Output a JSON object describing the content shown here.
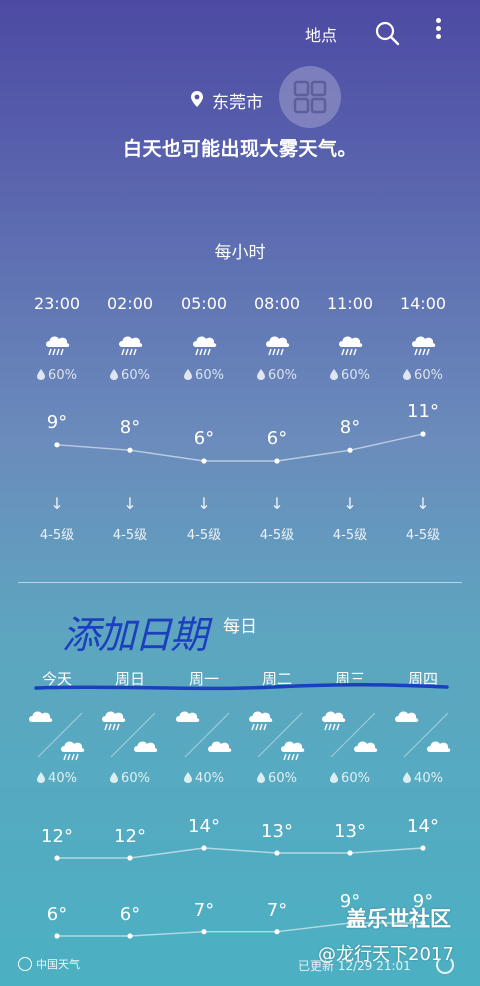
{
  "topbar": {
    "location_label": "地点",
    "search_icon": "search-icon",
    "more_icon": "more-vertical-icon"
  },
  "location": {
    "city": "东莞市",
    "pin_icon": "location-pin-icon",
    "badge_icon": "grid-icon"
  },
  "summary": "白天也可能出现大雾天气。",
  "hourly": {
    "title": "每小时",
    "items": [
      {
        "time": "23:00",
        "icon": "rain-cloud-icon",
        "precip": "60%",
        "temp": "9°",
        "temp_value": 9,
        "wind_arrow": "↓",
        "wind_level": "4-5级"
      },
      {
        "time": "02:00",
        "icon": "rain-cloud-icon",
        "precip": "60%",
        "temp": "8°",
        "temp_value": 8,
        "wind_arrow": "↓",
        "wind_level": "4-5级"
      },
      {
        "time": "05:00",
        "icon": "rain-cloud-icon",
        "precip": "60%",
        "temp": "6°",
        "temp_value": 6,
        "wind_arrow": "↓",
        "wind_level": "4-5级"
      },
      {
        "time": "08:00",
        "icon": "rain-cloud-icon",
        "precip": "60%",
        "temp": "6°",
        "temp_value": 6,
        "wind_arrow": "↓",
        "wind_level": "4-5级"
      },
      {
        "time": "11:00",
        "icon": "rain-cloud-icon",
        "precip": "60%",
        "temp": "8°",
        "temp_value": 8,
        "wind_arrow": "↓",
        "wind_level": "4-5级"
      },
      {
        "time": "14:00",
        "icon": "rain-cloud-icon",
        "precip": "60%",
        "temp": "11°",
        "temp_value": 11,
        "wind_arrow": "↓",
        "wind_level": "4-5级"
      }
    ]
  },
  "daily": {
    "title": "每日",
    "handwritten_note": "添加日期",
    "items": [
      {
        "day": "今天",
        "day_icon": "cloud-icon",
        "night_icon": "rain-cloud-icon",
        "precip": "40%",
        "high": "12°",
        "high_value": 12,
        "low": "6°",
        "low_value": 6
      },
      {
        "day": "周日",
        "day_icon": "rain-cloud-icon",
        "night_icon": "cloud-icon",
        "precip": "60%",
        "high": "12°",
        "high_value": 12,
        "low": "6°",
        "low_value": 6
      },
      {
        "day": "周一",
        "day_icon": "cloud-icon",
        "night_icon": "cloud-icon",
        "precip": "40%",
        "high": "14°",
        "high_value": 14,
        "low": "7°",
        "low_value": 7
      },
      {
        "day": "周二",
        "day_icon": "rain-cloud-icon",
        "night_icon": "rain-cloud-icon",
        "precip": "60%",
        "high": "13°",
        "high_value": 13,
        "low": "7°",
        "low_value": 7
      },
      {
        "day": "周三",
        "day_icon": "rain-cloud-icon",
        "night_icon": "cloud-icon",
        "precip": "60%",
        "high": "13°",
        "high_value": 13,
        "low": "9°",
        "low_value": 9
      },
      {
        "day": "周四",
        "day_icon": "cloud-icon",
        "night_icon": "cloud-icon",
        "precip": "40%",
        "high": "14°",
        "high_value": 14,
        "low": "9°",
        "low_value": 9
      }
    ]
  },
  "footer": {
    "brand": "中国天气",
    "updated": "已更新  12/29  21:01",
    "refresh_icon": "refresh-icon"
  },
  "watermark": {
    "line1": "盖乐世社区",
    "line2": "@龙行天下2017"
  },
  "colors": {
    "gradient_top": "#4d4aa3",
    "gradient_bottom": "#4bb0c2",
    "handwriting": "#1c3fbe"
  }
}
